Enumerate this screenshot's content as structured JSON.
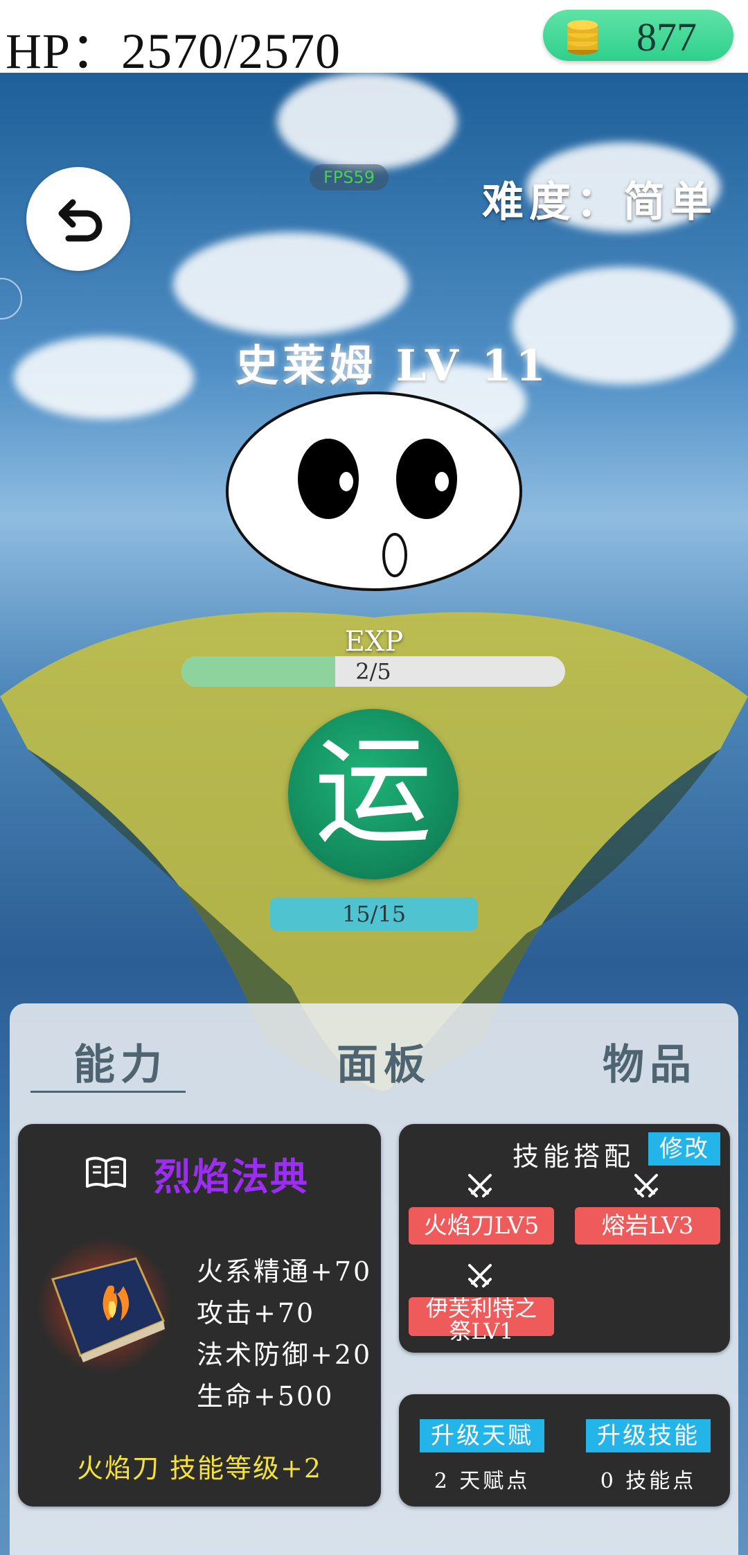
{
  "header": {
    "hp_text": "HP：2570/2570",
    "coins": "877"
  },
  "scene": {
    "fps": "FPS59",
    "difficulty": "难度：简单",
    "monster_name": "史莱姆 LV 11",
    "exp_label": "EXP",
    "exp_text": "2/5",
    "exp_progress": 0.4,
    "action_button": "运",
    "energy_text": "15/15"
  },
  "tabs": [
    "能力",
    "面板",
    "物品"
  ],
  "item_card": {
    "title": "烈焰法典",
    "stats": [
      "火系精通+70",
      "攻击+70",
      "法术防御+20",
      "生命+500"
    ],
    "bonus": "火焰刀 技能等级+2"
  },
  "skills_card": {
    "title": "技能搭配",
    "modify_label": "修改",
    "skills": [
      "火焰刀LV5",
      "熔岩LV3",
      "伊芙利特之祭LV1"
    ]
  },
  "upgrade_card": {
    "talent_button": "升级天赋",
    "talent_points": "2 天赋点",
    "skill_button": "升级技能",
    "skill_points": "0 技能点"
  },
  "colors": {
    "coin_pill": "#3ed597",
    "item_title": "#9b2ef0",
    "bonus_text": "#f6e33a",
    "skill_chip": "#ef5a5a",
    "button_blue": "#23b4ea",
    "action_green": "#11865a",
    "exp_fill": "#8ed39e",
    "energy_bar": "#4fc3d0"
  },
  "icons": [
    "coin-stack-icon",
    "back-arrow-icon",
    "book-icon",
    "crossed-swords-icon"
  ]
}
